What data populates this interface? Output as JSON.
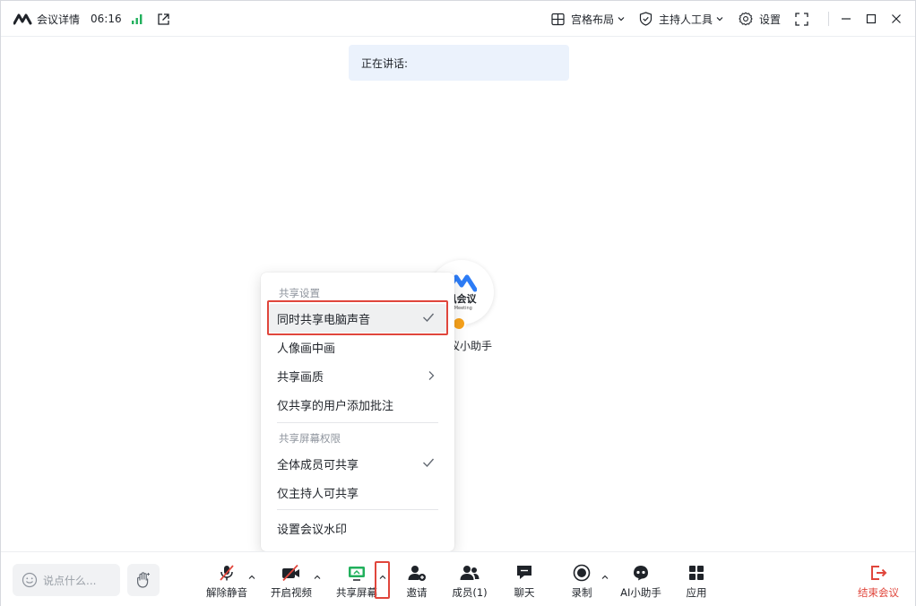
{
  "titlebar": {
    "meeting_details": "会议详情",
    "timer": "06:16",
    "layout": "宫格布局",
    "host_tools": "主持人工具",
    "settings": "设置"
  },
  "speaking": {
    "label": "正在讲话:"
  },
  "assistant": {
    "brand_text": "讯会议",
    "brand_sub": "t Meeting",
    "name": "议小助手"
  },
  "menu": {
    "group1_title": "共享设置",
    "items1": [
      {
        "label": "同时共享电脑声音",
        "checked": true
      },
      {
        "label": "人像画中画"
      },
      {
        "label": "共享画质",
        "submenu": true
      },
      {
        "label": "仅共享的用户添加批注"
      }
    ],
    "group2_title": "共享屏幕权限",
    "items2": [
      {
        "label": "全体成员可共享",
        "checked": true
      },
      {
        "label": "仅主持人可共享"
      }
    ],
    "items3": [
      {
        "label": "设置会议水印"
      }
    ]
  },
  "toolbar": {
    "chat_placeholder": "说点什么...",
    "unmute": "解除静音",
    "start_video": "开启视频",
    "share_screen": "共享屏幕",
    "invite": "邀请",
    "members": "成员(1)",
    "chat": "聊天",
    "record": "录制",
    "ai_assistant": "AI小助手",
    "apps": "应用",
    "end_meeting": "结束会议"
  },
  "colors": {
    "accent_green": "#21b05c",
    "danger_red": "#e0463c",
    "brand_blue": "#2d7cf6"
  }
}
